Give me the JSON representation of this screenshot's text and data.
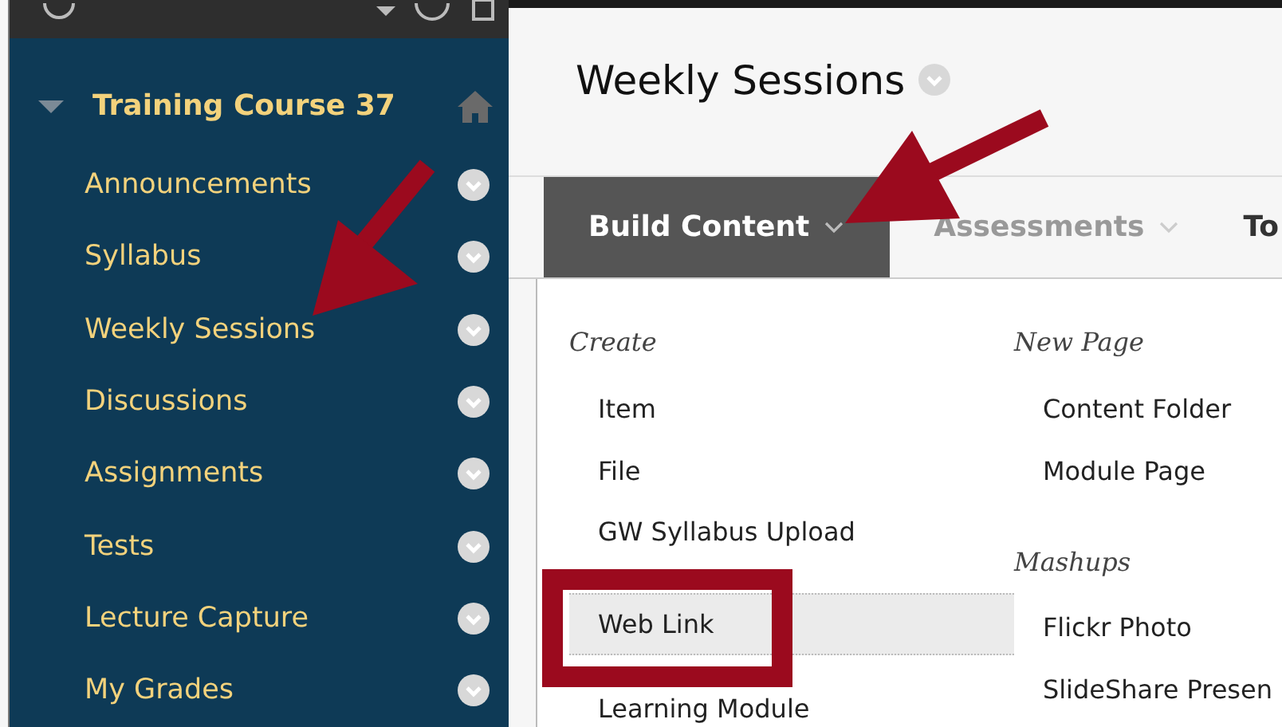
{
  "sidebar": {
    "course": {
      "title": "Training Course 37",
      "expanded": true
    },
    "items": [
      {
        "label": "Announcements"
      },
      {
        "label": "Syllabus"
      },
      {
        "label": "Weekly Sessions"
      },
      {
        "label": "Discussions"
      },
      {
        "label": "Assignments"
      },
      {
        "label": "Tests"
      },
      {
        "label": "Lecture Capture"
      },
      {
        "label": "My Grades"
      }
    ]
  },
  "page": {
    "title": "Weekly Sessions"
  },
  "tabs": [
    {
      "label": "Build Content",
      "selected": true
    },
    {
      "label": "Assessments",
      "selected": false
    },
    {
      "label": "To",
      "selected": false
    }
  ],
  "menu": {
    "columns": [
      {
        "sections": [
          {
            "heading": "Create",
            "items": [
              {
                "label": "Item",
                "selected": false
              },
              {
                "label": "File",
                "selected": false
              },
              {
                "label": "GW Syllabus Upload",
                "selected": false
              },
              {
                "label": "Web Link",
                "selected": true
              },
              {
                "label": "Learning Module",
                "selected": false
              }
            ]
          }
        ]
      },
      {
        "sections": [
          {
            "heading": "New Page",
            "items": [
              {
                "label": "Content Folder",
                "selected": false
              },
              {
                "label": "Module Page",
                "selected": false
              }
            ]
          },
          {
            "heading": "Mashups",
            "items": [
              {
                "label": "Flickr Photo",
                "selected": false
              },
              {
                "label": "SlideShare Presen",
                "selected": false
              }
            ]
          }
        ]
      }
    ]
  }
}
